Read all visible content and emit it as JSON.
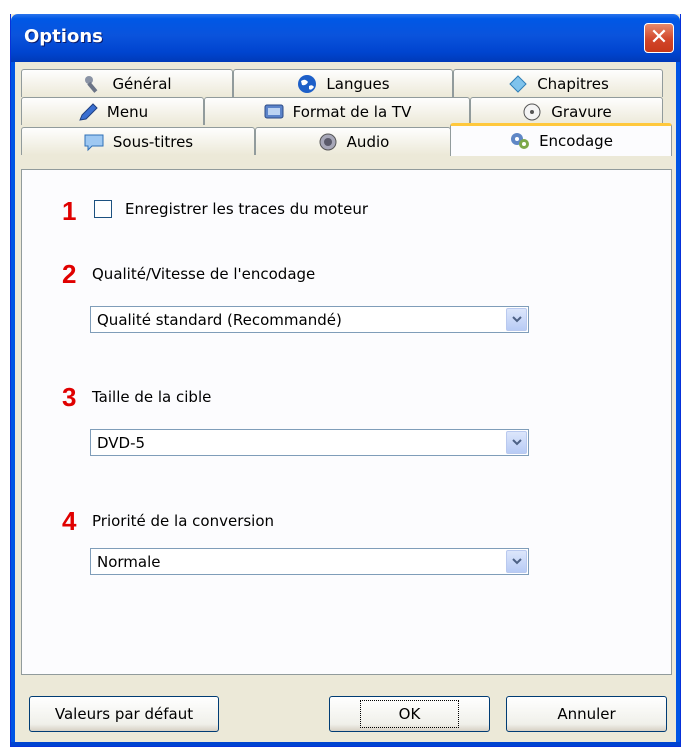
{
  "window": {
    "title": "Options",
    "close_symbol": "✕"
  },
  "tabs": {
    "row1": [
      {
        "label": "Général",
        "icon": "wrench-icon"
      },
      {
        "label": "Langues",
        "icon": "globe-icon"
      },
      {
        "label": "Chapitres",
        "icon": "bookmark-icon"
      }
    ],
    "row2": [
      {
        "label": "Menu",
        "icon": "pen-icon"
      },
      {
        "label": "Format de la TV",
        "icon": "tv-icon"
      },
      {
        "label": "Gravure",
        "icon": "disc-icon"
      }
    ],
    "row3": [
      {
        "label": "Sous-titres",
        "icon": "speech-bubble-icon"
      },
      {
        "label": "Audio",
        "icon": "speaker-icon"
      },
      {
        "label": "Encodage",
        "icon": "gears-icon",
        "active": true
      }
    ]
  },
  "encodage": {
    "item1": {
      "number": "1",
      "label": "Enregistrer les traces du moteur",
      "checked": false
    },
    "item2": {
      "number": "2",
      "label": "Qualité/Vitesse de l'encodage",
      "value": "Qualité standard (Recommandé)"
    },
    "item3": {
      "number": "3",
      "label": "Taille de la cible",
      "value": "DVD-5"
    },
    "item4": {
      "number": "4",
      "label": "Priorité de la conversion",
      "value": "Normale"
    }
  },
  "buttons": {
    "defaults": "Valeurs par défaut",
    "ok": "OK",
    "cancel": "Annuler"
  },
  "colors": {
    "accent_number": "#e00000",
    "active_tab_highlight": "#ffc83c",
    "titlebar": "#0058e6"
  }
}
